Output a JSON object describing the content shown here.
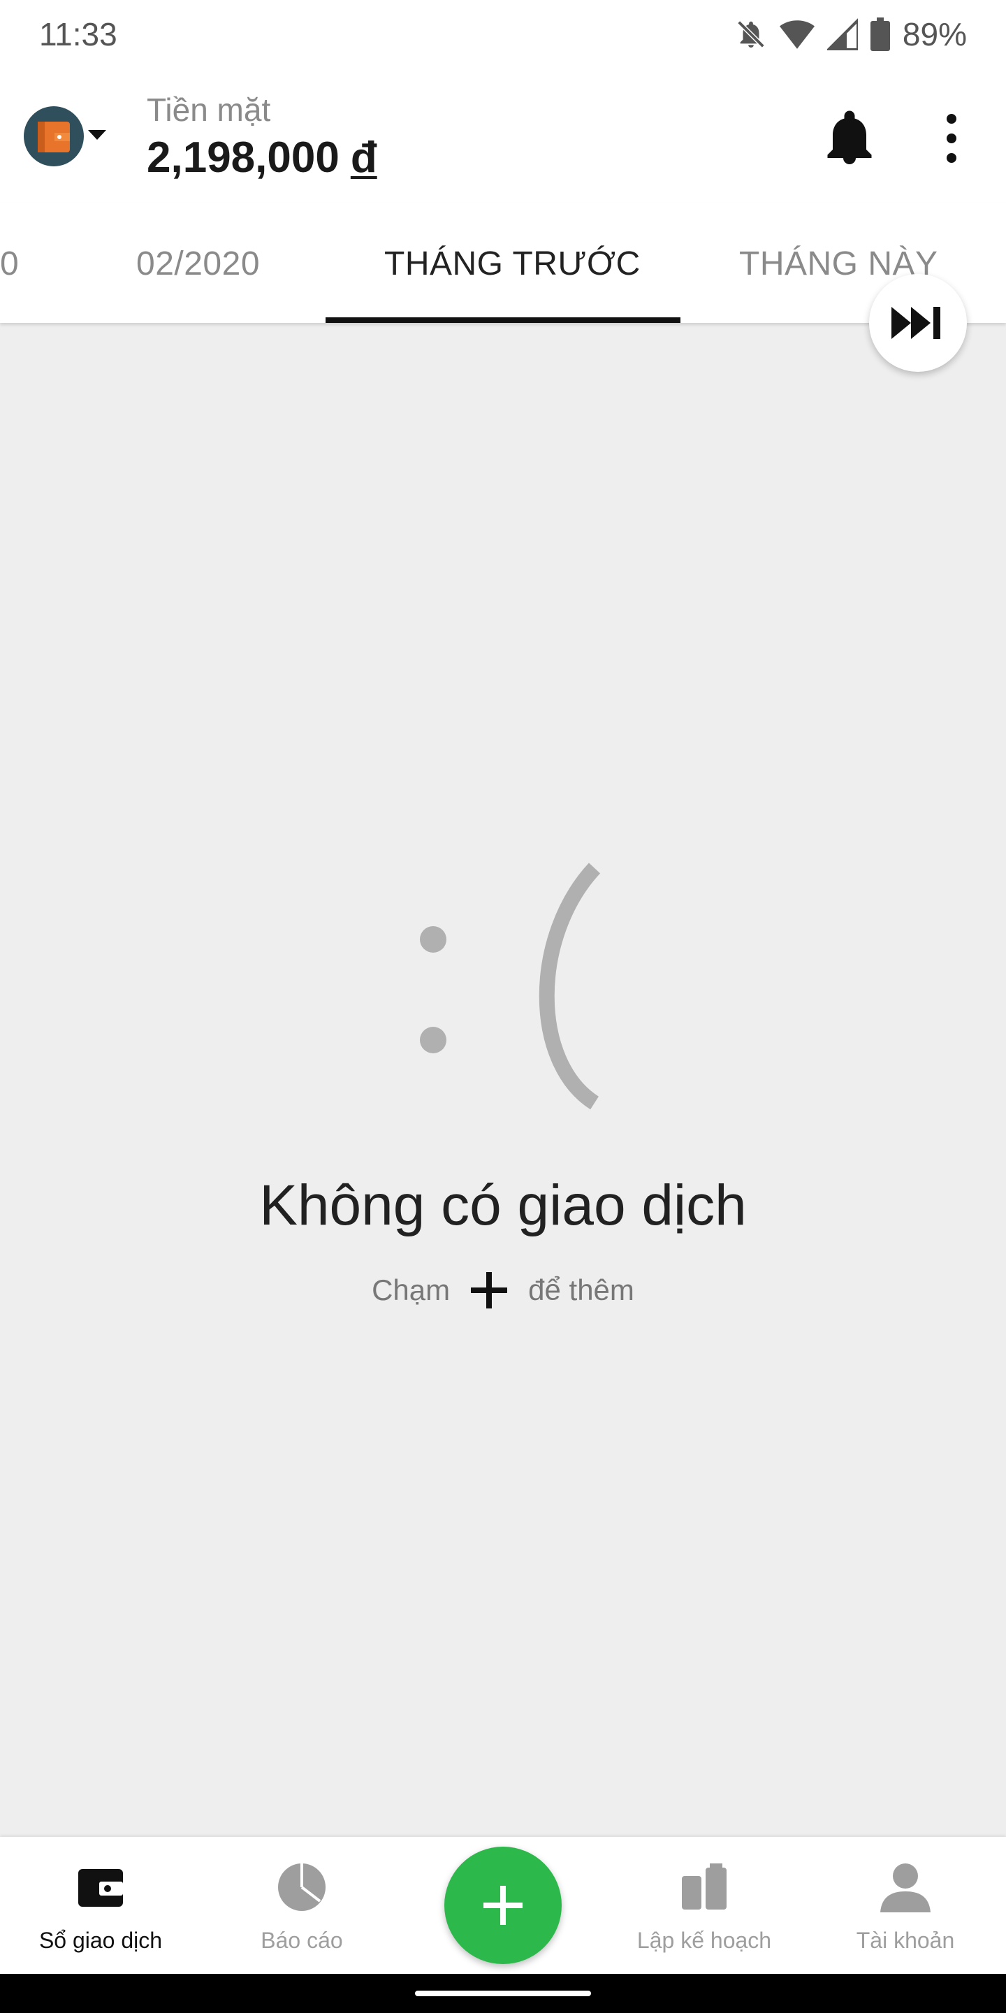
{
  "status_bar": {
    "time": "11:33",
    "battery_percent": "89%",
    "icons": [
      "bell-off-icon",
      "wifi-icon",
      "cellular-signal-icon",
      "battery-icon"
    ]
  },
  "header": {
    "wallet_name": "Tiền mặt",
    "balance": "2,198,000",
    "currency_symbol": "đ",
    "wallet_icon": "wallet-icon",
    "notification_icon": "bell-icon",
    "more_icon": "more-vertical-icon"
  },
  "tabs": {
    "items": [
      {
        "label": "0"
      },
      {
        "label": "02/2020"
      },
      {
        "label": "THÁNG TRƯỚC"
      },
      {
        "label": "THÁNG NÀY"
      }
    ],
    "active_index": 2,
    "jump_icon": "skip-forward-icon"
  },
  "empty_state": {
    "face": ": (",
    "title": "Không có giao dịch",
    "hint_before": "Chạm",
    "hint_icon": "plus-icon",
    "hint_after": "để thêm"
  },
  "bottom_nav": {
    "items": [
      {
        "label": "Sổ giao dịch",
        "icon": "wallet-icon",
        "active": true
      },
      {
        "label": "Báo cáo",
        "icon": "pie-chart-icon",
        "active": false
      },
      {
        "label": "Lập kế hoạch",
        "icon": "planning-icon",
        "active": false
      },
      {
        "label": "Tài khoản",
        "icon": "account-icon",
        "active": false
      }
    ],
    "fab_icon": "plus-icon"
  },
  "colors": {
    "accent_green": "#2db84b",
    "wallet_orange": "#e8732a",
    "background": "#eeeeee",
    "face_gray": "#b0b0b0"
  }
}
